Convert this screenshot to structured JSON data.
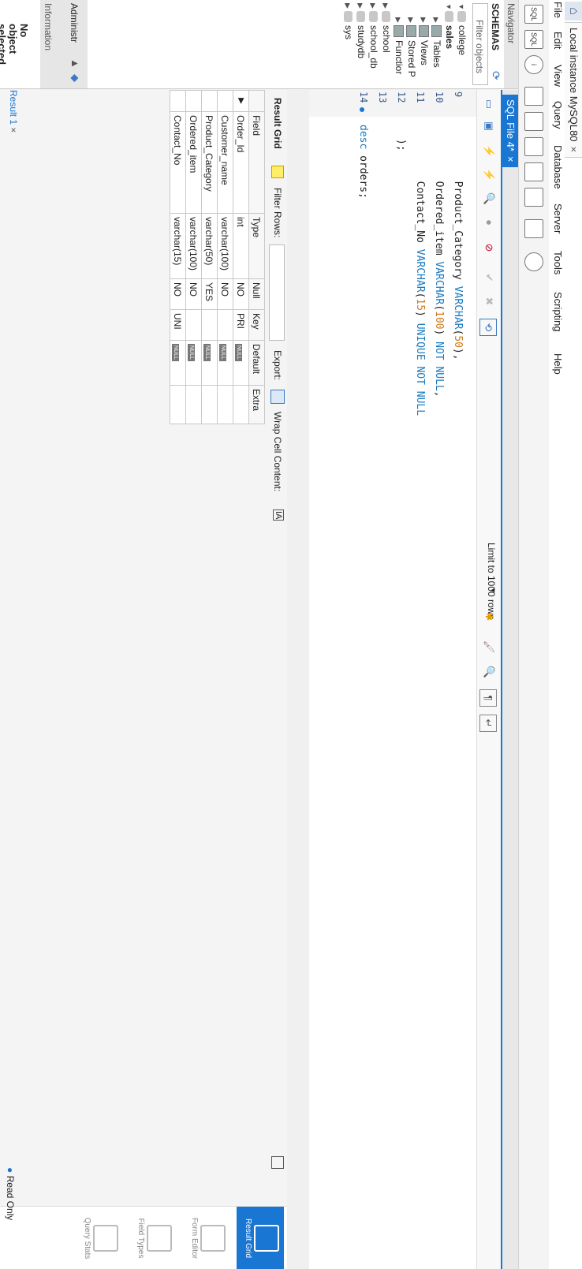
{
  "window": {
    "home_label": "⌂",
    "connection_tab": "Local instance MySQL80",
    "close": "×"
  },
  "menu": [
    "File",
    "Edit",
    "View",
    "Query",
    "Database",
    "Server",
    "Tools",
    "Scripting",
    "Help"
  ],
  "navigator": {
    "header": "Navigator",
    "schemas_label": "SCHEMAS",
    "filter_placeholder": "Filter objects",
    "tree": [
      {
        "label": "college",
        "type": "db",
        "expanded": true,
        "bold": false
      },
      {
        "label": "sales",
        "type": "db",
        "expanded": true,
        "bold": true
      },
      {
        "label": "Tables",
        "type": "folder"
      },
      {
        "label": "Views",
        "type": "folder"
      },
      {
        "label": "Stored P",
        "type": "folder"
      },
      {
        "label": "Functior",
        "type": "folder"
      },
      {
        "label": "school",
        "type": "db",
        "expanded": false
      },
      {
        "label": "school_db",
        "type": "db",
        "expanded": false
      },
      {
        "label": "studydb",
        "type": "db",
        "expanded": false
      },
      {
        "label": "sys",
        "type": "db",
        "expanded": false
      }
    ],
    "admin_tab": "Administr",
    "info_header": "Information",
    "no_object": [
      "No",
      "object",
      "selected"
    ]
  },
  "editor": {
    "tab_label": "SQL File 4*",
    "limit_label": "Limit to 1000 rows",
    "lines": [
      {
        "num": "9",
        "text": ""
      },
      {
        "num": "10",
        "text": ""
      },
      {
        "num": "11",
        "text": ""
      },
      {
        "num": "12",
        "text": ""
      },
      {
        "num": "13",
        "text": ""
      },
      {
        "num": "14",
        "text": ""
      }
    ],
    "code": {
      "l9a": "  Product_Category ",
      "l9kw": "VARCHAR",
      "l9p1": "(",
      "l9num": "50",
      "l9p2": "),",
      "l10a": "  Ordered_item ",
      "l10kw": "VARCHAR",
      "l10p1": "(",
      "l10num": "100",
      "l10p2": ") ",
      "l10kw2": "NOT NULL",
      "l10p3": ",",
      "l11a": "  Contact_No ",
      "l11kw": "VARCHAR",
      "l11p1": "(",
      "l11num": "15",
      "l11p2": ") ",
      "l11kw2": "UNIQUE NOT NULL",
      "l12": ");",
      "l14kw": "desc",
      "l14rest": " orders;"
    }
  },
  "results": {
    "result_grid_label": "Result Grid",
    "filter_rows_label": "Filter Rows:",
    "export_label": "Export:",
    "wrap_label": "Wrap Cell Content:",
    "columns": [
      "Field",
      "Type",
      "Null",
      "Key",
      "Default",
      "Extra"
    ],
    "rows": [
      [
        "Order_Id",
        "int",
        "NO",
        "PRI",
        "NULL",
        ""
      ],
      [
        "Customer_name",
        "varchar(100)",
        "NO",
        "",
        "NULL",
        ""
      ],
      [
        "Product_Category",
        "varchar(50)",
        "YES",
        "",
        "NULL",
        ""
      ],
      [
        "Ordered_item",
        "varchar(100)",
        "NO",
        "",
        "NULL",
        ""
      ],
      [
        "Contact_No",
        "varchar(15)",
        "NO",
        "UNI",
        "NULL",
        ""
      ]
    ],
    "bottom_tab": "Result 1",
    "side_buttons": [
      "Result Grid",
      "Form Editor",
      "Field Types",
      "Query Stats"
    ]
  },
  "status": "Read Only"
}
